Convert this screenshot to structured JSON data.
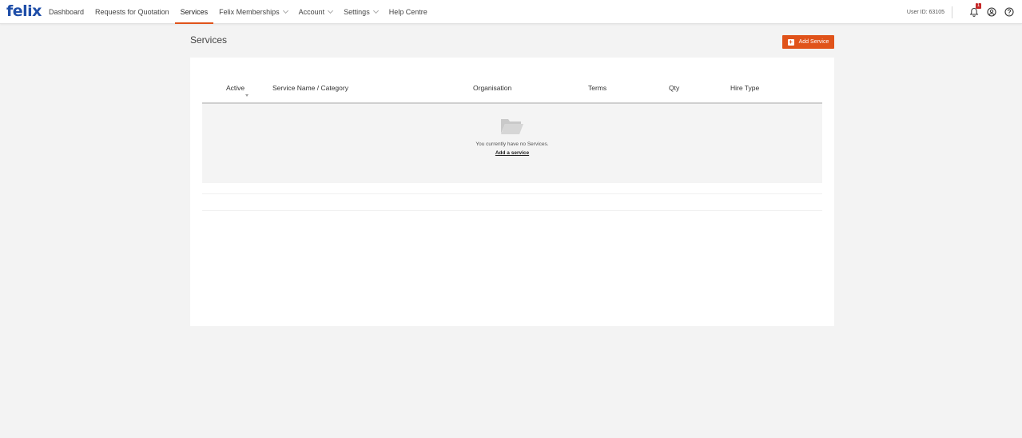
{
  "brand": {
    "logo_text": "felix",
    "logo_color": "#1f4ea8",
    "accent_color": "#e0531a"
  },
  "nav": {
    "items": [
      {
        "label": "Dashboard",
        "active": false,
        "dropdown": false
      },
      {
        "label": "Requests for Quotation",
        "active": false,
        "dropdown": false
      },
      {
        "label": "Services",
        "active": true,
        "dropdown": false
      },
      {
        "label": "Felix Memberships",
        "active": false,
        "dropdown": true
      },
      {
        "label": "Account",
        "active": false,
        "dropdown": true
      },
      {
        "label": "Settings",
        "active": false,
        "dropdown": true
      },
      {
        "label": "Help Centre",
        "active": false,
        "dropdown": false
      }
    ]
  },
  "header_tools": {
    "user_id": "User ID: 63105",
    "notification_count": "1",
    "icons": [
      "bell-icon",
      "user-circle-icon",
      "help-circle-icon"
    ]
  },
  "page": {
    "title": "Services",
    "add_button_label": "Add Service"
  },
  "table": {
    "columns": [
      "Active",
      "Service Name / Category",
      "Organisation",
      "Terms",
      "Qty",
      "Hire Type"
    ],
    "empty_message": "You currently have no Services.",
    "empty_link": "Add a service"
  }
}
